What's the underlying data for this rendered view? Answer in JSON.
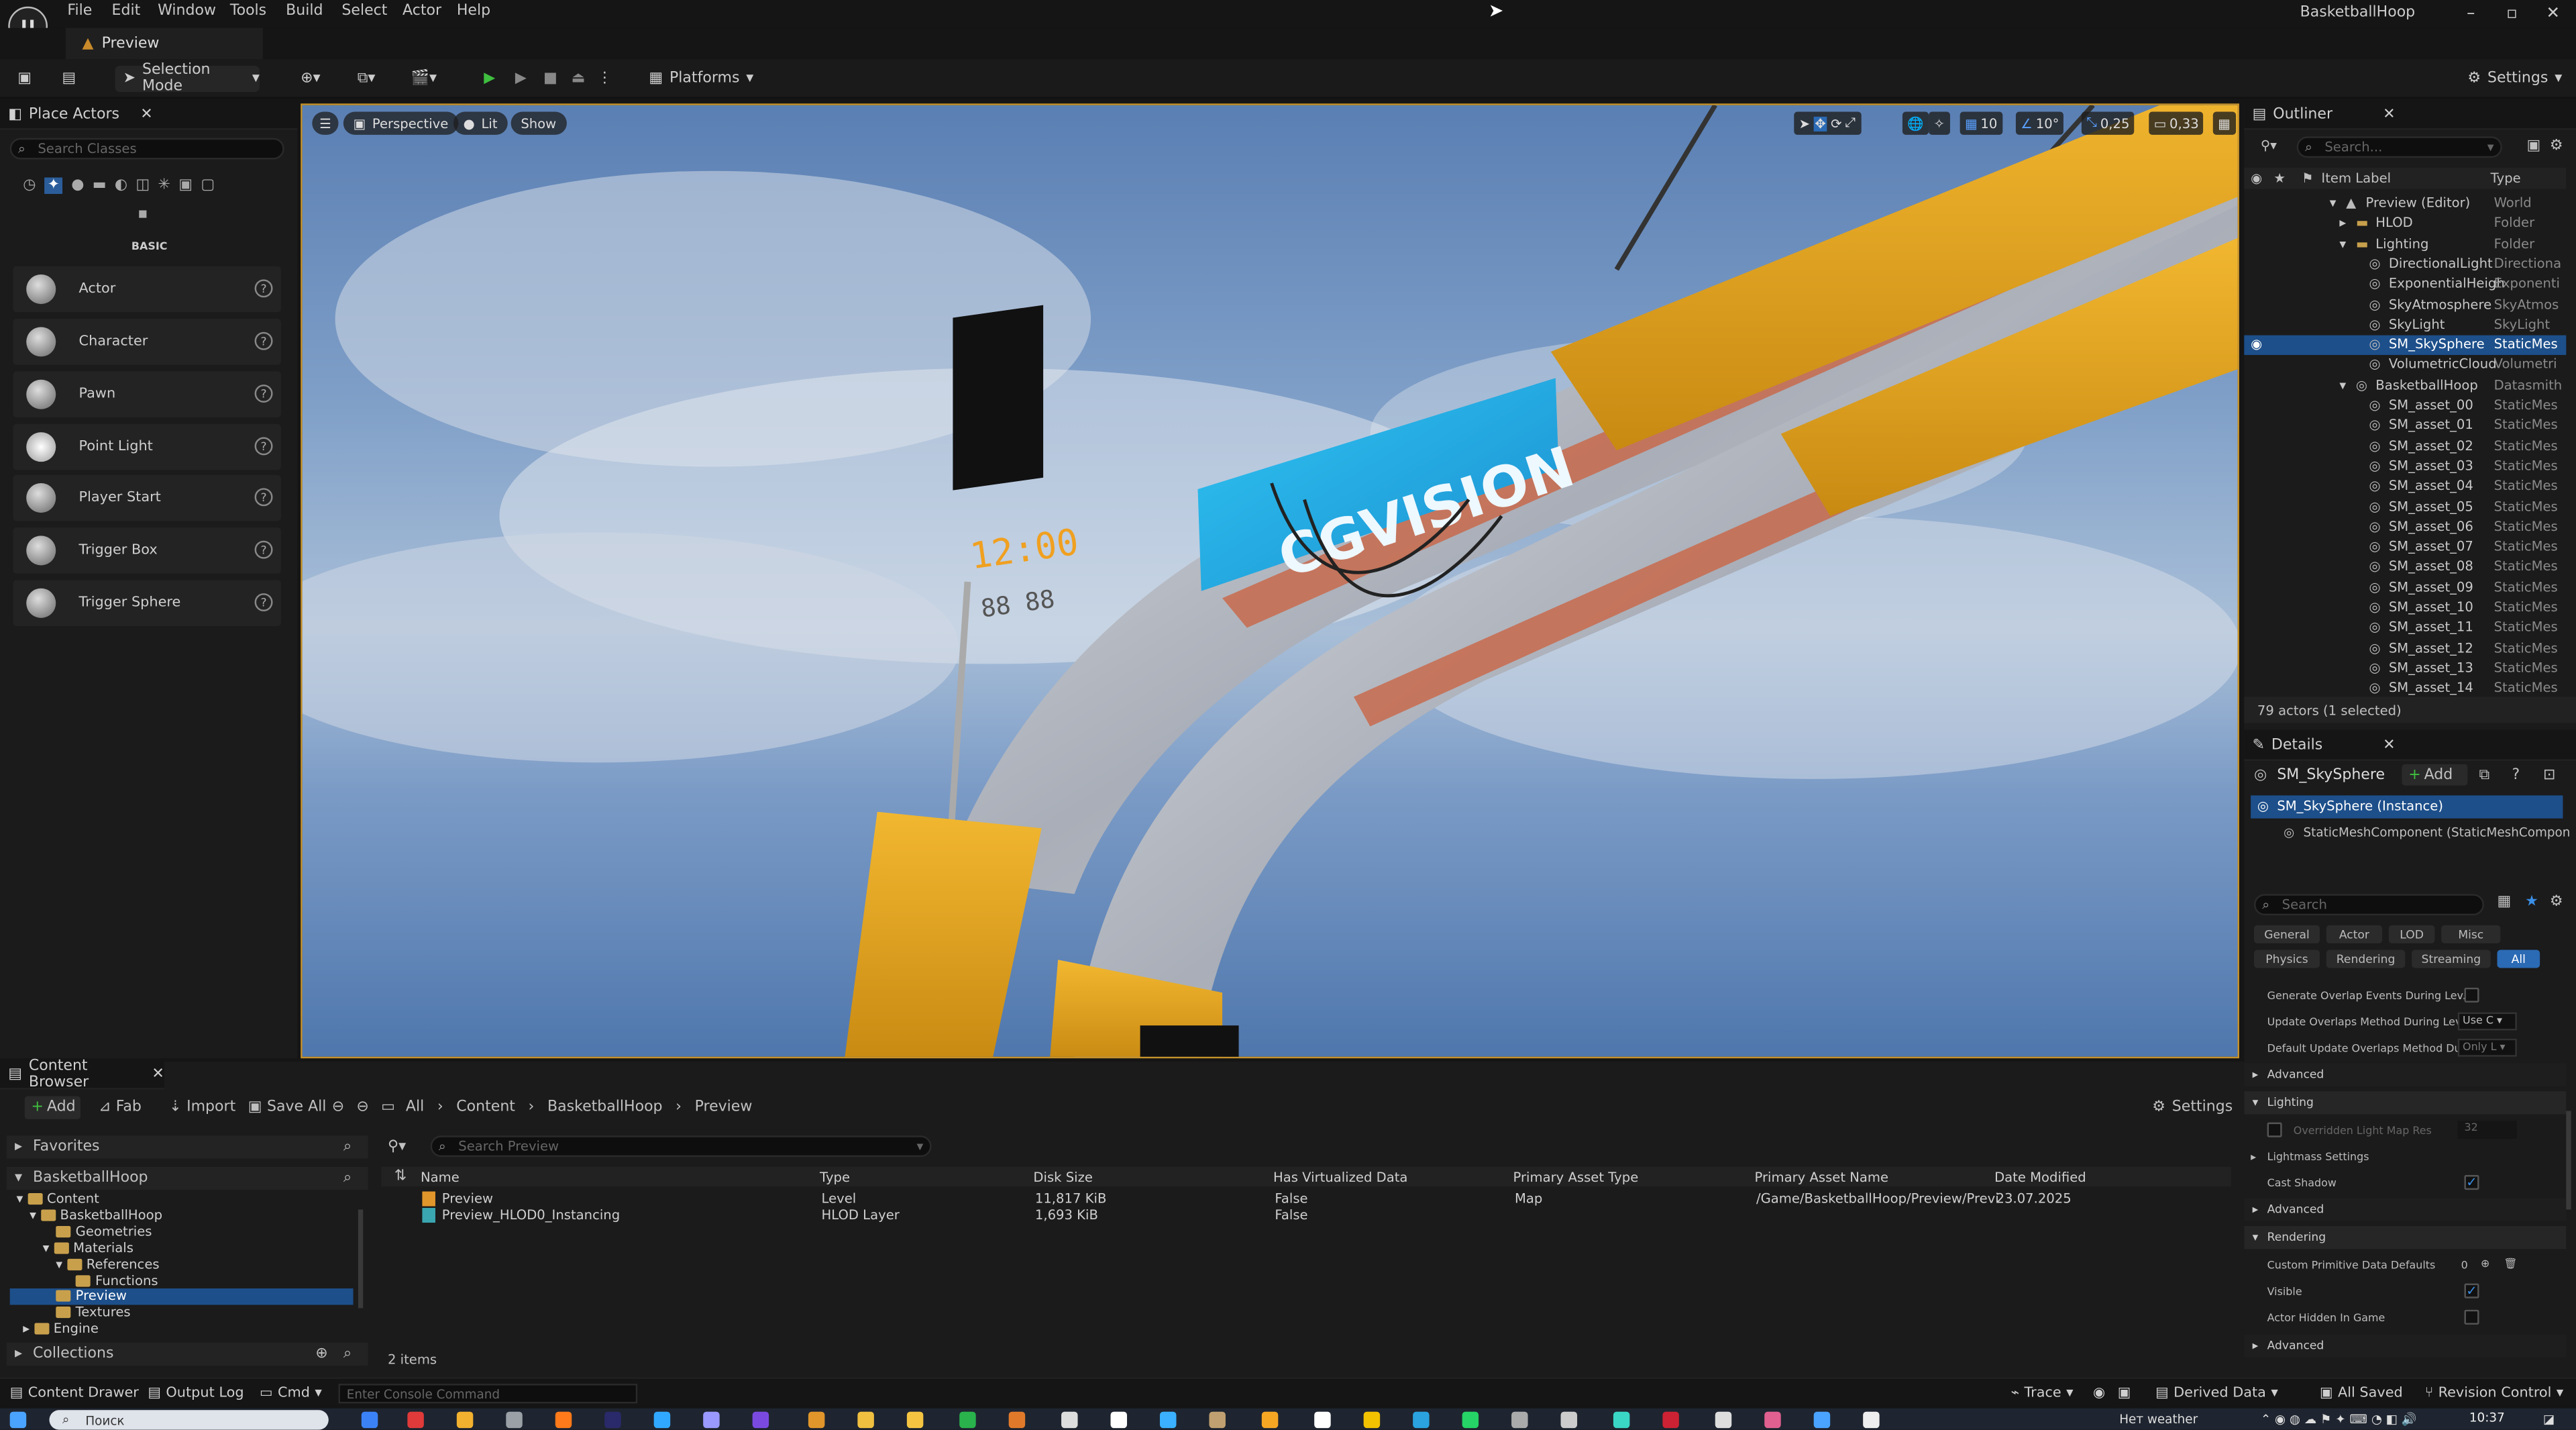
{
  "menubar": {
    "items": [
      "File",
      "Edit",
      "Window",
      "Tools",
      "Build",
      "Select",
      "Actor",
      "Help"
    ],
    "window_title": "BasketballHoop"
  },
  "tab": {
    "label": "Preview"
  },
  "toolbar": {
    "selection_mode": "Selection Mode",
    "platforms": "Platforms",
    "settings": "Settings"
  },
  "place_actors": {
    "title": "Place Actors",
    "search_placeholder": "Search Classes",
    "category": "BASIC",
    "items": [
      "Actor",
      "Character",
      "Pawn",
      "Point Light",
      "Player Start",
      "Trigger Box",
      "Trigger Sphere"
    ]
  },
  "viewport": {
    "perspective": "Perspective",
    "lit": "Lit",
    "show": "Show",
    "grid_snap": "10",
    "rot_snap": "10°",
    "scale_snap": "0,25",
    "cam_speed": "0,33",
    "sign_text": "CGVISION",
    "clock_text": "12:00",
    "clock_sub": "88 88"
  },
  "outliner": {
    "title": "Outliner",
    "search_placeholder": "Search...",
    "col_label": "Item Label",
    "col_type": "Type",
    "rows": [
      {
        "name": "Preview (Editor)",
        "type": "World"
      },
      {
        "name": "HLOD",
        "type": "Folder"
      },
      {
        "name": "Lighting",
        "type": "Folder"
      },
      {
        "name": "DirectionalLight",
        "type": "Directiona"
      },
      {
        "name": "ExponentialHeigh",
        "type": "Exponenti"
      },
      {
        "name": "SkyAtmosphere",
        "type": "SkyAtmos"
      },
      {
        "name": "SkyLight",
        "type": "SkyLight"
      },
      {
        "name": "SM_SkySphere",
        "type": "StaticMes"
      },
      {
        "name": "VolumetricCloud",
        "type": "Volumetri"
      },
      {
        "name": "BasketballHoop",
        "type": "Datasmith"
      },
      {
        "name": "SM_asset_00",
        "type": "StaticMes"
      },
      {
        "name": "SM_asset_01",
        "type": "StaticMes"
      },
      {
        "name": "SM_asset_02",
        "type": "StaticMes"
      },
      {
        "name": "SM_asset_03",
        "type": "StaticMes"
      },
      {
        "name": "SM_asset_04",
        "type": "StaticMes"
      },
      {
        "name": "SM_asset_05",
        "type": "StaticMes"
      },
      {
        "name": "SM_asset_06",
        "type": "StaticMes"
      },
      {
        "name": "SM_asset_07",
        "type": "StaticMes"
      },
      {
        "name": "SM_asset_08",
        "type": "StaticMes"
      },
      {
        "name": "SM_asset_09",
        "type": "StaticMes"
      },
      {
        "name": "SM_asset_10",
        "type": "StaticMes"
      },
      {
        "name": "SM_asset_11",
        "type": "StaticMes"
      },
      {
        "name": "SM_asset_12",
        "type": "StaticMes"
      },
      {
        "name": "SM_asset_13",
        "type": "StaticMes"
      },
      {
        "name": "SM_asset_14",
        "type": "StaticMes"
      }
    ],
    "footer": "79 actors (1 selected)"
  },
  "details": {
    "title": "Details",
    "object": "SM_SkySphere",
    "add": "Add",
    "instance": "SM_SkySphere (Instance)",
    "component": "StaticMeshComponent (StaticMeshCompon",
    "search_placeholder": "Search",
    "filters": [
      "General",
      "Actor",
      "LOD",
      "Misc",
      "Physics",
      "Rendering",
      "Streaming",
      "All"
    ],
    "rows": {
      "gen_overlap": "Generate Overlap Events During Lev...",
      "upd_overlap": "Update Overlaps Method During Lev...",
      "upd_overlap_val": "Use C",
      "def_overlap": "Default Update Overlaps Method Du...",
      "def_overlap_val": "Only L",
      "advanced": "Advanced",
      "lighting": "Lighting",
      "override_lm": "Overridden Light Map Res",
      "override_lm_val": "32",
      "lightmass": "Lightmass Settings",
      "cast_shadow": "Cast Shadow",
      "rendering": "Rendering",
      "cpd": "Custom Primitive Data Defaults",
      "cpd_val": "0",
      "visible": "Visible",
      "hidden_game": "Actor Hidden In Game"
    }
  },
  "content_browser": {
    "title": "Content Browser",
    "add": "Add",
    "fab": "Fab",
    "import": "Import",
    "save_all": "Save All",
    "breadcrumb": [
      "All",
      "Content",
      "BasketballHoop",
      "Preview"
    ],
    "settings": "Settings",
    "favorites": "Favorites",
    "project": "BasketballHoop",
    "tree": [
      "Content",
      "BasketballHoop",
      "Geometries",
      "Materials",
      "References",
      "Functions",
      "Preview",
      "Textures",
      "Engine"
    ],
    "collections": "Collections",
    "search_placeholder": "Search Preview",
    "columns": [
      "Name",
      "Type",
      "Disk Size",
      "Has Virtualized Data",
      "Primary Asset Type",
      "Primary Asset Name",
      "Date Modified"
    ],
    "rows": [
      [
        "Preview",
        "Level",
        "11,817 KiB",
        "False",
        "Map",
        "/Game/BasketballHoop/Preview/Previ",
        "23.07.2025"
      ],
      [
        "Preview_HLOD0_Instancing",
        "HLOD Layer",
        "1,693 KiB",
        "False",
        "",
        "",
        ""
      ]
    ],
    "count": "2 items"
  },
  "statusbar": {
    "content_drawer": "Content Drawer",
    "output_log": "Output Log",
    "cmd": "Cmd",
    "console_placeholder": "Enter Console Command",
    "trace": "Trace",
    "derived": "Derived Data",
    "saved": "All Saved",
    "revision": "Revision Control"
  },
  "taskbar": {
    "search": "Поиск",
    "weather": "Нет weather",
    "time": "10:37"
  }
}
